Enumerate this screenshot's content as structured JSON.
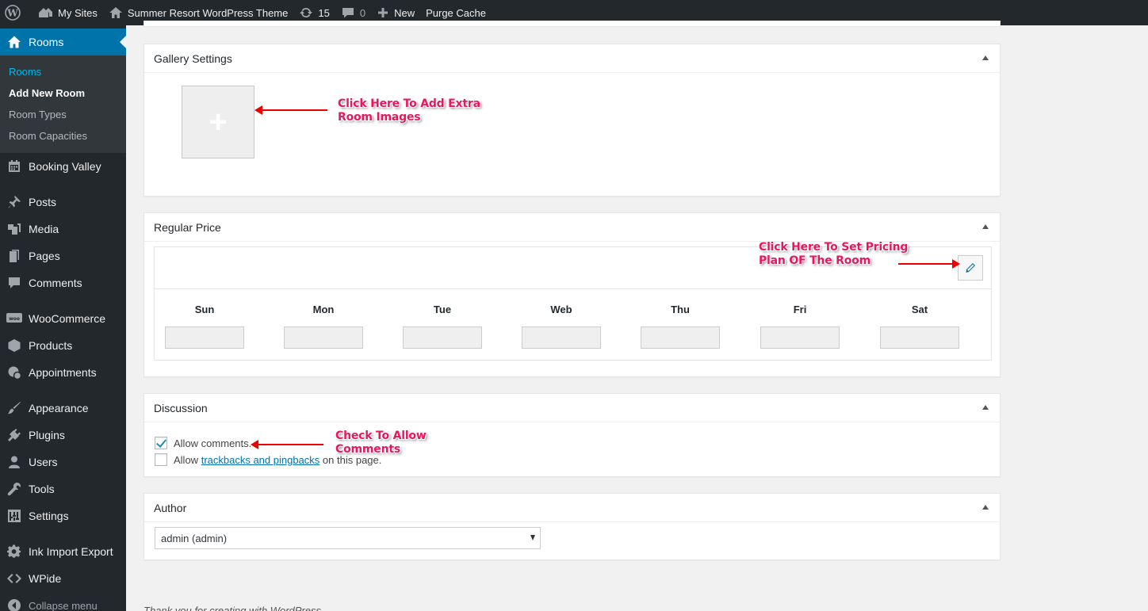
{
  "adminbar": {
    "my_sites": "My Sites",
    "site_name": "Summer Resort WordPress Theme",
    "updates_count": "15",
    "comments_count": "0",
    "new_label": "New",
    "purge_cache": "Purge Cache"
  },
  "sidebar": {
    "current": "Rooms",
    "submenu": [
      "Rooms",
      "Add New Room",
      "Room Types",
      "Room Capacities"
    ],
    "items": [
      "Booking Valley",
      "Posts",
      "Media",
      "Pages",
      "Comments",
      "WooCommerce",
      "Products",
      "Appointments",
      "Appearance",
      "Plugins",
      "Users",
      "Tools",
      "Settings",
      "Ink Import Export",
      "WPide"
    ],
    "collapse": "Collapse menu"
  },
  "gallery": {
    "title": "Gallery Settings",
    "add_symbol": "+",
    "annotation": "Click Here To Add Extra Room Images"
  },
  "price": {
    "title": "Regular Price",
    "days": [
      "Sun",
      "Mon",
      "Tue",
      "Web",
      "Thu",
      "Fri",
      "Sat"
    ],
    "annotation": "Click Here To Set Pricing Plan OF The Room"
  },
  "discussion": {
    "title": "Discussion",
    "allow_comments": "Allow comments.",
    "allow_trackbacks_pre": "Allow ",
    "allow_trackbacks_link": "trackbacks and pingbacks",
    "allow_trackbacks_post": " on this page.",
    "annotation": "Check To Allow Comments"
  },
  "author": {
    "title": "Author",
    "selected": "admin (admin)"
  },
  "footer": {
    "text": "Thank you for creating with WordPress."
  },
  "colors": {
    "accent": "#0073aa",
    "annotation": "#e8175d",
    "arrow": "#ee0000"
  }
}
